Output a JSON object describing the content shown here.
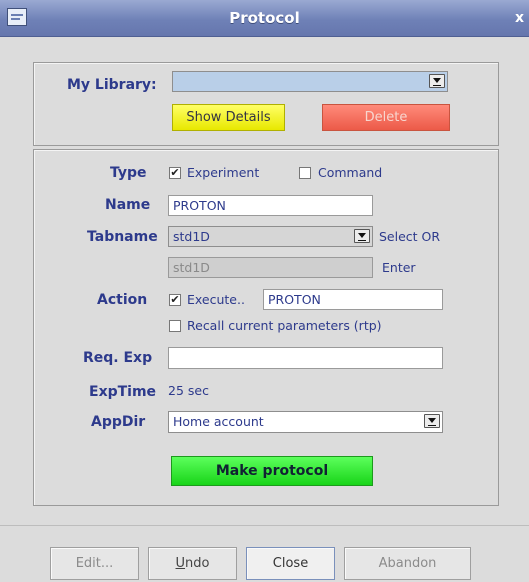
{
  "window": {
    "title": "Protocol",
    "close_glyph": "x"
  },
  "library": {
    "label": "My Library:",
    "selected": "",
    "show_details": "Show Details",
    "delete": "Delete"
  },
  "form": {
    "type_label": "Type",
    "experiment_label": "Experiment",
    "experiment_checked": true,
    "command_label": "Command",
    "command_checked": false,
    "name_label": "Name",
    "name_value": "PROTON",
    "tabname_label": "Tabname",
    "tabname_selected": "std1D",
    "select_or": "Select OR",
    "tabname_enter_value": "std1D",
    "enter": "Enter",
    "action_label": "Action",
    "execute_label": "Execute..",
    "execute_checked": true,
    "execute_value": "PROTON",
    "recall_label": "Recall current parameters (rtp)",
    "recall_checked": false,
    "reqexp_label": "Req. Exp",
    "reqexp_value": "",
    "exptime_label": "ExpTime",
    "exptime_value": "25 sec",
    "appdir_label": "AppDir",
    "appdir_selected": "Home account",
    "make_protocol": "Make protocol"
  },
  "footer": {
    "edit": "Edit...",
    "undo_u": "U",
    "undo_rest": "ndo",
    "close": "Close",
    "abandon": "Abandon"
  },
  "colors": {
    "label_blue": "#2d3a8c",
    "yellow_button": "#ffff33",
    "red_button": "#ec5a48",
    "green_button": "#33ee33",
    "library_combo": "#b9cfe8"
  }
}
